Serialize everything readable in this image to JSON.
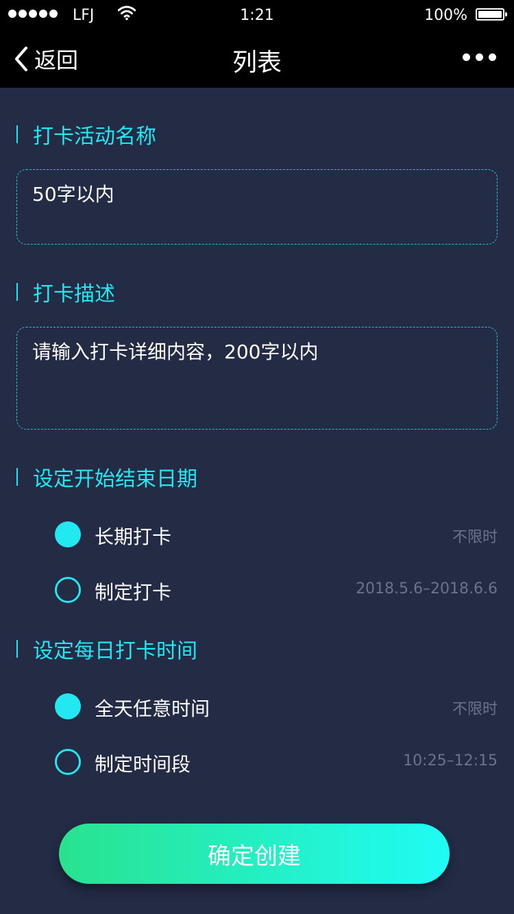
{
  "status_bar": {
    "carrier": "LFJ",
    "time": "1:21",
    "battery": "100%"
  },
  "nav": {
    "back_label": "返回",
    "title": "列表"
  },
  "sections": {
    "name": {
      "title": "打卡活动名称",
      "placeholder": "50字以内"
    },
    "description": {
      "title": "打卡描述",
      "placeholder": "请输入打卡详细内容，200字以内"
    },
    "date_range": {
      "title": "设定开始结束日期",
      "options": [
        {
          "label": "长期打卡",
          "value": "不限时",
          "selected": true
        },
        {
          "label": "制定打卡",
          "value": "2018.5.6–2018.6.6",
          "selected": false
        }
      ]
    },
    "daily_time": {
      "title": "设定每日打卡时间",
      "options": [
        {
          "label": "全天任意时间",
          "value": "不限时",
          "selected": true
        },
        {
          "label": "制定时间段",
          "value": "10:25–12:15",
          "selected": false
        }
      ]
    }
  },
  "confirm_label": "确定创建",
  "colors": {
    "background": "#232b45",
    "accent": "#22e8f2",
    "muted_text": "#6c7289",
    "button_gradient_start": "#29e28f",
    "button_gradient_end": "#1ffcf5"
  }
}
